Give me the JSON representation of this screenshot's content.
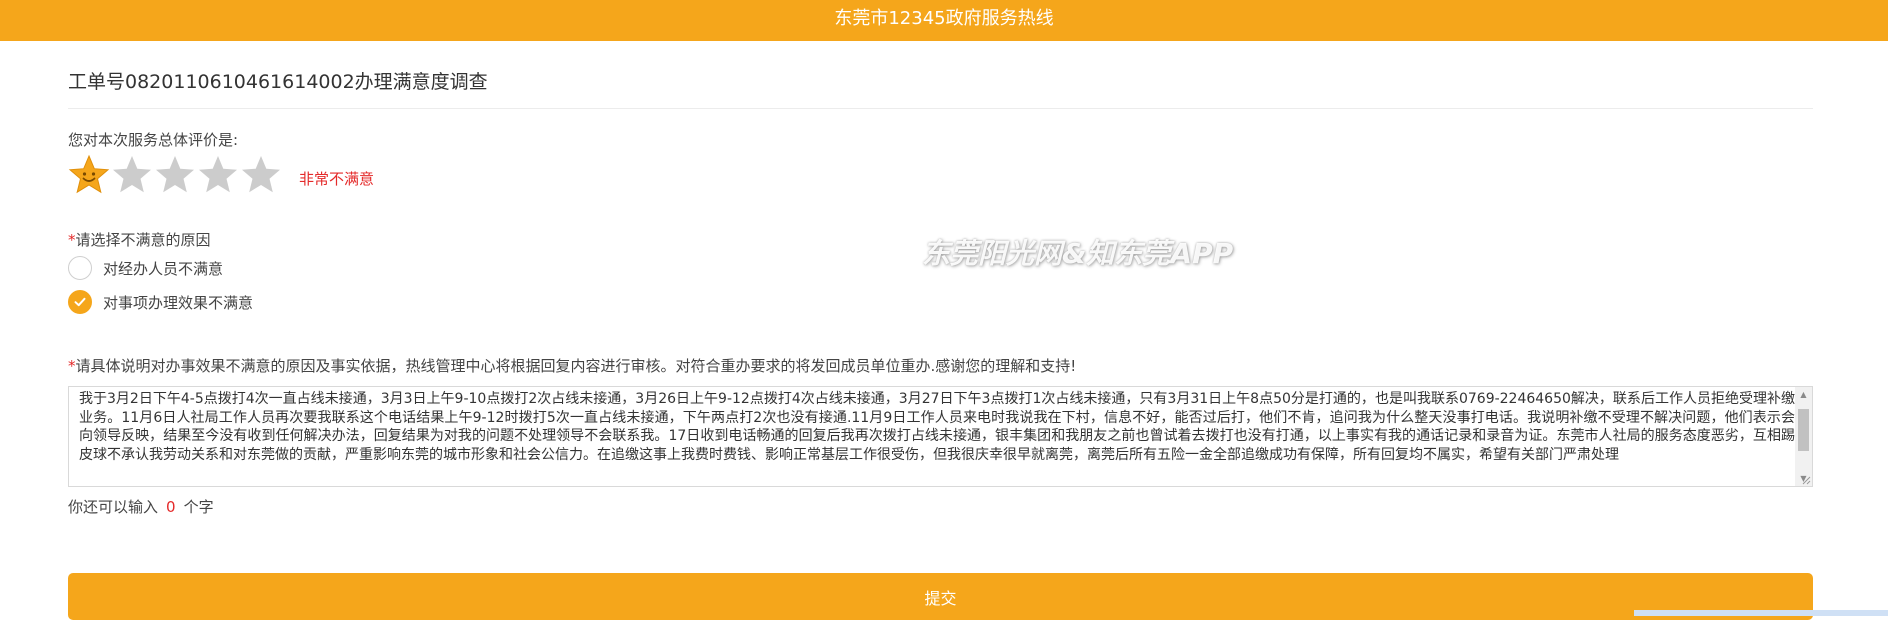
{
  "header": {
    "title": "东莞市12345政府服务热线"
  },
  "survey": {
    "order_title": "工单号08201106104616140​02办理满意度调查",
    "rating_label": "您对本次服务总体评价是:",
    "rating": {
      "value": 1,
      "max": 5,
      "text": "非常不满意"
    },
    "reason": {
      "required_mark": "*",
      "label": "请选择不满意的原因",
      "options": [
        {
          "label": "对经办人员不满意",
          "checked": false
        },
        {
          "label": "对事项办理效果不满意",
          "checked": true
        }
      ]
    },
    "detail": {
      "required_mark": "*",
      "label": "请具体说明对办事效果不满意的原因及事实依据，热线管理中心将根据回复内容进行审核。对符合重办要求的将发回成员单位重办.感谢您的理解和支持!",
      "text": "我于3月2日下午4-5点拨打4次一直占线未接通，3月3日上午9-10点拨打2次占线未接通，3月26日上午9-12点拨打4次占线未接通，3月27日下午3点拨打1次占线未接通，只有3月31日上午8点50分是打通的，也是叫我联系0769-22464650解决，联系后工作人员拒绝受理补缴业务。11月6日人社局工作人员再次要我联系这个电话结果上午9-12时拨打5次一直占线未接通，下午两点打2次也没有接通.11月9日工作人员来电时我说我在下村，信息不好，能否过后打，他们不肯，追问我为什么整天没事打电话。我说明补缴不受理不解决问题，他们表示会向领导反映，结果至今没有收到任何解决办法，回复结果为对我的问题不处理领导不会联系我。17日收到电话畅通的回复后我再次拨打占线未接通，银丰集团和我朋友之前也曾试着去拨打也没有打通，以上事实有我的通话记录和录音为证。东莞市人社局的服务态度恶劣，互相踢皮球不承认我劳动关系和对东莞做的贡献，严重影响东莞的城市形象和社会公信力。在追缴这事上我费时费钱、影响正常基层工作很受伤，但我很庆幸很早就离莞，离莞后所有五险一金全部追缴成功有保障，所有回复均不属实，希望有关部门严肃处理"
    },
    "counter": {
      "prefix": "你还可以输入",
      "remaining": "0",
      "suffix": "个字"
    },
    "submit_label": "提交"
  },
  "watermark": "东莞阳光网&知东莞APP",
  "colors": {
    "accent": "#f5a61b",
    "alert": "#e42a2a",
    "star_off": "#cccccc"
  },
  "icons": {
    "star_active": "smiling-star-icon",
    "star_inactive": "star-icon",
    "radio_checked": "check-icon"
  }
}
